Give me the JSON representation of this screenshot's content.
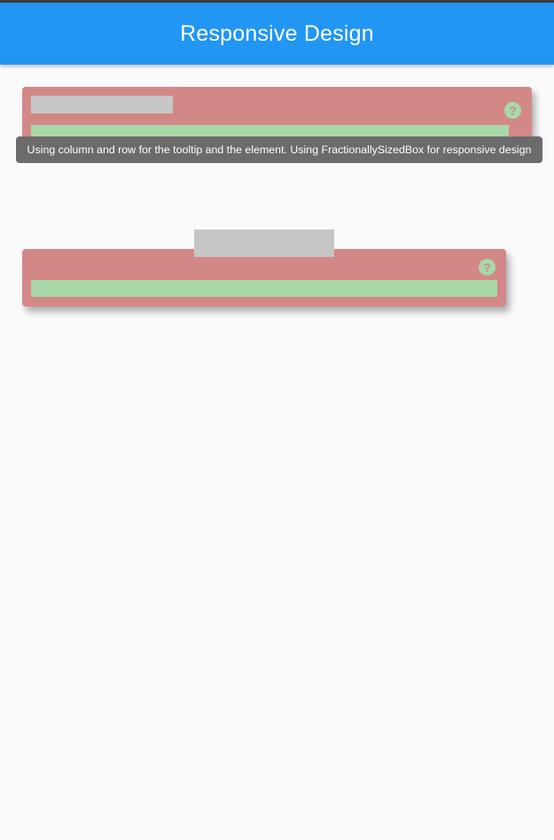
{
  "app_bar": {
    "title": "Responsive Design",
    "color": "#2196f3"
  },
  "cards": [
    {
      "help_icon": "?",
      "help_icon_name": "question-mark-icon"
    },
    {
      "help_icon": "?",
      "help_icon_name": "question-mark-icon"
    }
  ],
  "tooltip": {
    "text": "Using column and row for the tooltip and the element. Using FractionallySizedBox for responsive design"
  },
  "colors": {
    "card": "#d38888",
    "placeholder": "#c6c6c6",
    "bar": "#a8d8a8",
    "tooltip": "#6b6b6b",
    "background": "#fafafa"
  }
}
